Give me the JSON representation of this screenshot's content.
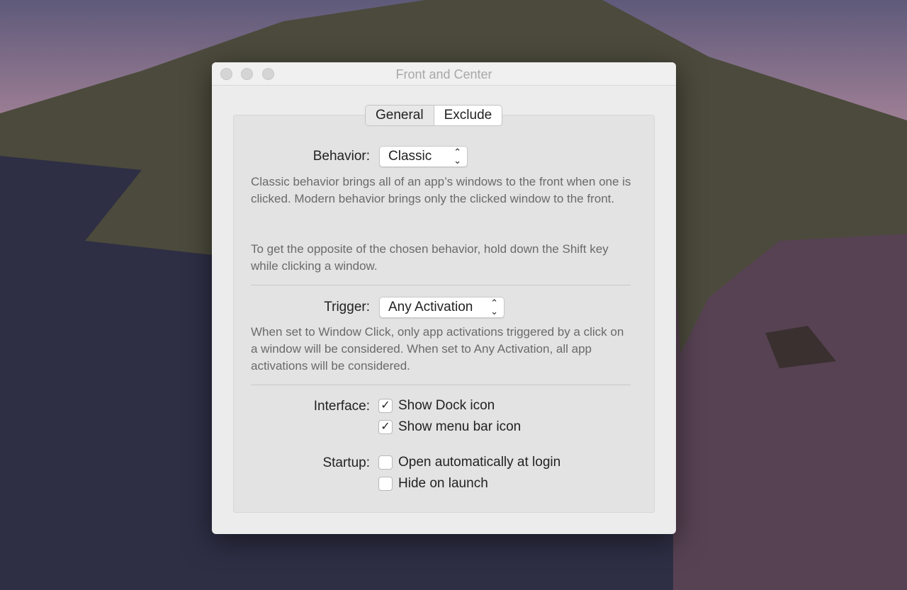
{
  "window": {
    "title": "Front and Center"
  },
  "tabs": [
    {
      "label": "General",
      "selected": true
    },
    {
      "label": "Exclude",
      "selected": false
    }
  ],
  "behavior": {
    "label": "Behavior:",
    "value": "Classic",
    "desc1": "Classic behavior brings all of an app’s windows to the front when one is clicked. Modern behavior brings only the clicked window to the front.",
    "desc2": "To get the opposite of the chosen behavior, hold down the Shift key while clicking a window."
  },
  "trigger": {
    "label": "Trigger:",
    "value": "Any Activation",
    "desc": "When set to Window Click, only app activations triggered by a click on a window will be considered. When set to Any Activation, all app activations will be considered."
  },
  "interface": {
    "label": "Interface:",
    "options": [
      {
        "label": "Show Dock icon",
        "checked": true
      },
      {
        "label": "Show menu bar icon",
        "checked": true
      }
    ]
  },
  "startup": {
    "label": "Startup:",
    "options": [
      {
        "label": "Open automatically at login",
        "checked": false
      },
      {
        "label": "Hide on launch",
        "checked": false
      }
    ]
  },
  "check_glyph": "✓",
  "updown_glyph": "⌃⌄"
}
